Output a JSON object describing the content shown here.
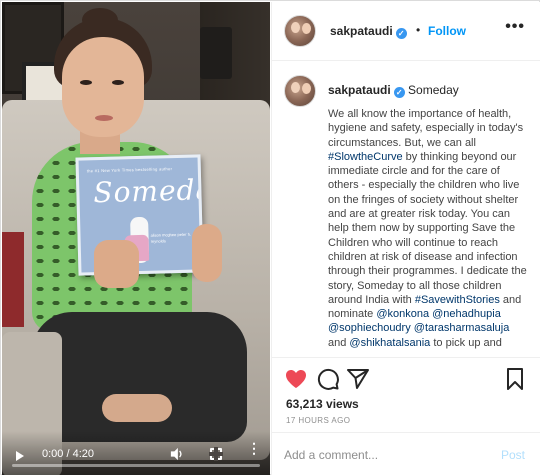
{
  "video": {
    "book": {
      "top_text": "the #1 New York Times bestselling author",
      "title": "Someday",
      "authors": "alison mcghee  peter h. reynolds"
    },
    "controls": {
      "time": "0:00 / 4:20",
      "progress": 0
    }
  },
  "header": {
    "username": "sakpataudi",
    "dot": "•",
    "follow_label": "Follow",
    "more_icon": "more-options-icon"
  },
  "caption": {
    "username": "sakpataudi",
    "title": "Someday",
    "body_parts": [
      {
        "t": "We all know the importance of health, hygiene and safety, especially in today's circumstances. But, we can all "
      },
      {
        "t": "#SlowtheCurve",
        "tag": true
      },
      {
        "t": " by thinking beyond our immediate circle and for the care of others - especially the children who live on the fringes of society without shelter and are at greater risk today. You can help them now by supporting Save the Children who will continue to reach children at risk of disease and infection through their programmes. I dedicate the story, Someday to all those children around India with "
      },
      {
        "t": "#SavewithStories",
        "tag": true
      },
      {
        "t": " and nominate "
      },
      {
        "t": "@konkona",
        "tag": true
      },
      {
        "t": " "
      },
      {
        "t": "@nehadhupia",
        "tag": true
      },
      {
        "t": " "
      },
      {
        "t": "@sophiechoudry",
        "tag": true
      },
      {
        "t": " "
      },
      {
        "t": "@tarasharmasaluja",
        "tag": true
      },
      {
        "t": " and "
      },
      {
        "t": "@shikhatalsania",
        "tag": true
      },
      {
        "t": " to pick up and"
      }
    ]
  },
  "stats": {
    "views": "63,213 views",
    "ago": "17 HOURS AGO"
  },
  "comment": {
    "placeholder": "Add a comment...",
    "post_label": "Post"
  },
  "colors": {
    "like_red": "#ed4956",
    "follow_blue": "#0095f6",
    "post_disabled": "#b2dffc"
  }
}
